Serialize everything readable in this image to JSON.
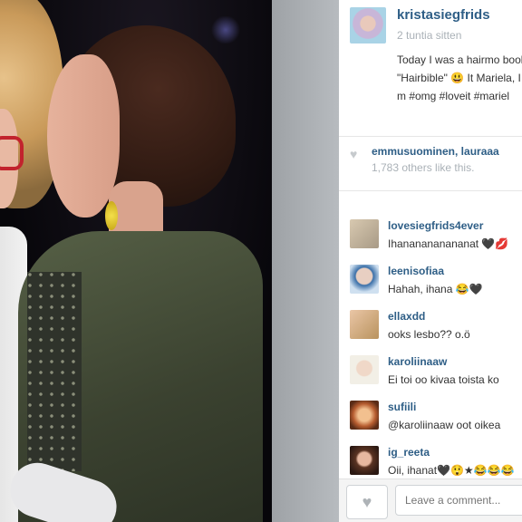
{
  "post": {
    "username": "kristasiegfrids",
    "time": "2 tuntia sitten",
    "caption": "Today I was a hairmo book \"Hairbible\" 😃 It Mariela, I finally got m #omg #loveit #mariel"
  },
  "likes": {
    "icon": "heart-icon",
    "likers": "emmusuominen, lauraaa",
    "count_text": "1,783 others like this."
  },
  "comments": [
    {
      "username": "lovesiegfrids4ever",
      "text": "Ihananananananat 🖤💋"
    },
    {
      "username": "leenisofiaa",
      "text": "Hahah, ihana 😂🖤"
    },
    {
      "username": "ellaxdd",
      "text": "ooks lesbo?? o.ö"
    },
    {
      "username": "karoliinaaw",
      "text": "Ei toi oo kivaa toista ko"
    },
    {
      "username": "sufiili",
      "text": "@karoliinaaw oot oikea"
    },
    {
      "username": "ig_reeta",
      "text": "Oii, ihanat🖤😲★😂😂😂"
    }
  ],
  "footer": {
    "like_button_icon": "heart-icon",
    "comment_placeholder": "Leave a comment..."
  },
  "colors": {
    "username": "#2e5e86",
    "muted": "#aab1b7",
    "gutter": "#a9adb1"
  }
}
